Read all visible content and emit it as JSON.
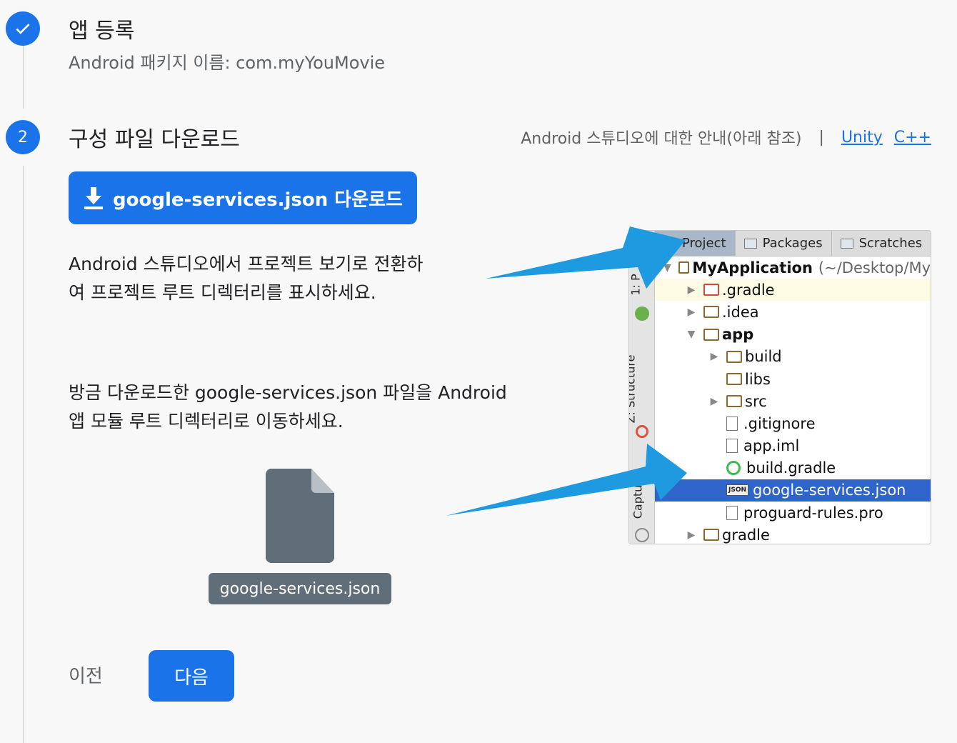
{
  "step1": {
    "number": "✓",
    "title": "앱 등록",
    "subtitle": "Android 패키지 이름: com.myYouMovie"
  },
  "step2": {
    "number": "2",
    "title": "구성 파일 다운로드",
    "guide": {
      "text": "Android 스튜디오에 대한 안내(아래 참조)",
      "separator": "|",
      "links": [
        "Unity",
        "C++"
      ]
    },
    "download_button": "google-services.json 다운로드",
    "instruction1": [
      "Android 스튜디오에서 프로젝트 보기로 전환하",
      "여 프로젝트 루트 디렉터리를 표시하세요."
    ],
    "instruction2": [
      "방금 다운로드한 google-services.json 파일을 Android",
      "앱 모듈 루트 디렉터리로 이동하세요."
    ],
    "file_label": "google-services.json"
  },
  "ide": {
    "tabs": [
      "Project",
      "Packages",
      "Scratches"
    ],
    "side_tabs": [
      "1: P",
      "Z: Structure",
      "Captu"
    ],
    "tree": [
      {
        "label": "MyApplication",
        "suffix": "(~/Desktop/My",
        "depth": 0,
        "arrow": "open",
        "icon": "module",
        "bold": true
      },
      {
        "label": ".gradle",
        "depth": 1,
        "arrow": "closed",
        "icon": "folder-red"
      },
      {
        "label": ".idea",
        "depth": 1,
        "arrow": "closed",
        "icon": "folder"
      },
      {
        "label": "app",
        "depth": 1,
        "arrow": "open",
        "icon": "module",
        "bold": true
      },
      {
        "label": "build",
        "depth": 2,
        "arrow": "closed",
        "icon": "folder"
      },
      {
        "label": "libs",
        "depth": 2,
        "arrow": "none",
        "icon": "folder"
      },
      {
        "label": "src",
        "depth": 2,
        "arrow": "closed",
        "icon": "folder"
      },
      {
        "label": ".gitignore",
        "depth": 2,
        "arrow": "none",
        "icon": "doc"
      },
      {
        "label": "app.iml",
        "depth": 2,
        "arrow": "none",
        "icon": "doc"
      },
      {
        "label": "build.gradle",
        "depth": 2,
        "arrow": "none",
        "icon": "gradle"
      },
      {
        "label": "google-services.json",
        "depth": 2,
        "arrow": "none",
        "icon": "json",
        "selected": true
      },
      {
        "label": "proguard-rules.pro",
        "depth": 2,
        "arrow": "none",
        "icon": "doc"
      },
      {
        "label": "gradle",
        "depth": 1,
        "arrow": "closed",
        "icon": "folder"
      }
    ]
  },
  "actions": {
    "prev": "이전",
    "next": "다음"
  },
  "colors": {
    "accent": "#1a73e8",
    "arrow": "#1e9be0",
    "selection": "#2f65ca"
  }
}
